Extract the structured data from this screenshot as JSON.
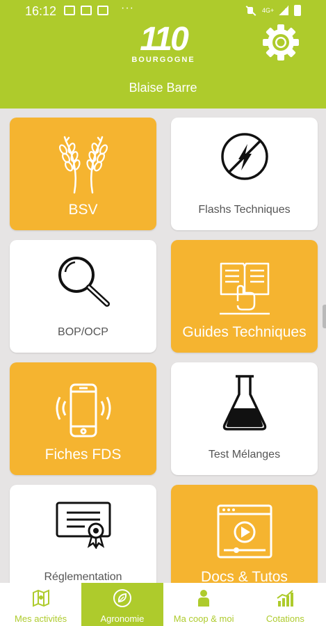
{
  "status_bar": {
    "time": "16:12",
    "more": "···",
    "network": "4G+"
  },
  "header": {
    "logo_number": "110",
    "logo_subtitle": "BOURGOGNE",
    "user_name": "Blaise Barre",
    "settings_icon": "gear-icon"
  },
  "tiles": [
    {
      "label": "BSV",
      "icon": "wheat-icon",
      "style": "orange"
    },
    {
      "label": "Flashs Techniques",
      "icon": "lightning-icon",
      "style": "white"
    },
    {
      "label": "BOP/OCP",
      "icon": "magnifier-icon",
      "style": "white"
    },
    {
      "label": "Guides Techniques",
      "icon": "book-icon",
      "style": "orange"
    },
    {
      "label": "Fiches FDS",
      "icon": "phone-icon",
      "style": "orange"
    },
    {
      "label": "Test Mélanges",
      "icon": "flask-icon",
      "style": "white"
    },
    {
      "label": "Réglementation",
      "icon": "certificate-icon",
      "style": "white"
    },
    {
      "label": "Docs & Tutos",
      "icon": "video-icon",
      "style": "orange"
    }
  ],
  "bottom_nav": [
    {
      "label": "Mes activités",
      "icon": "map-icon",
      "active": false
    },
    {
      "label": "Agronomie",
      "icon": "leaf-icon",
      "active": true
    },
    {
      "label": "Ma coop & moi",
      "icon": "person-icon",
      "active": false
    },
    {
      "label": "Cotations",
      "icon": "chart-icon",
      "active": false
    }
  ],
  "colors": {
    "brand_green": "#aecb2c",
    "tile_orange": "#f5b430",
    "background": "#e6e4e4"
  }
}
